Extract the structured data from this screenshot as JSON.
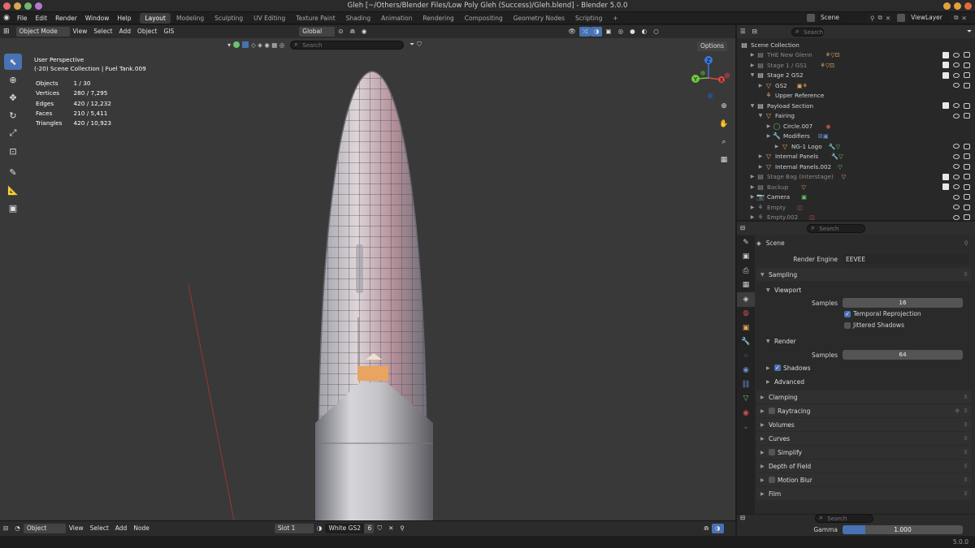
{
  "window": {
    "title": "Gleh [~/Others/Blender Files/Low Poly Gleh (Success)/Gleh.blend] - Blender 5.0.0"
  },
  "menu": [
    "File",
    "Edit",
    "Render",
    "Window",
    "Help"
  ],
  "workspaces": [
    "Layout",
    "Modeling",
    "Sculpting",
    "UV Editing",
    "Texture Paint",
    "Shading",
    "Animation",
    "Rendering",
    "Compositing",
    "Geometry Nodes",
    "Scripting",
    "+"
  ],
  "topright": {
    "scene": "Scene",
    "view_layer": "ViewLayer"
  },
  "viewport_header": {
    "mode": "Object Mode",
    "menus": [
      "View",
      "Select",
      "Add",
      "Object",
      "GIS"
    ],
    "orientation": "Global",
    "options": "Options",
    "search_placeholder": "Search"
  },
  "viewport": {
    "perspective": "User Perspective",
    "collection_line": "(-20) Scene Collection | Fuel Tank.009",
    "stats": [
      {
        "label": "Objects",
        "value": "1 / 30"
      },
      {
        "label": "Vertices",
        "value": "280 / 7,295"
      },
      {
        "label": "Edges",
        "value": "420 / 12,232"
      },
      {
        "label": "Faces",
        "value": "210 / 5,411"
      },
      {
        "label": "Triangles",
        "value": "420 / 10,923"
      }
    ]
  },
  "gizmo": {
    "z": "Z",
    "y": "Y",
    "x": "X"
  },
  "shader_header": {
    "editor": "Object",
    "menus": [
      "View",
      "Select",
      "Add",
      "Node"
    ],
    "slot": "Slot 1",
    "material": "White GS2",
    "users": "6"
  },
  "outliner": {
    "search_placeholder": "Search",
    "rows": [
      {
        "label": "Scene Collection",
        "dim": false
      },
      {
        "label": "THE New Glenn",
        "dim": true
      },
      {
        "label": "Stage 1 / GS1",
        "dim": true
      },
      {
        "label": "Stage 2 GS2",
        "dim": false
      },
      {
        "label": "GS2",
        "dim": false
      },
      {
        "label": "Upper Reference",
        "dim": false
      },
      {
        "label": "Payload Section",
        "dim": false
      },
      {
        "label": "Fairing",
        "dim": false
      },
      {
        "label": "Circle.007",
        "dim": false
      },
      {
        "label": "Modifiers",
        "dim": false
      },
      {
        "label": "NG-1 Logo",
        "dim": false
      },
      {
        "label": "Internal Panels",
        "dim": false
      },
      {
        "label": "Internal Panels.002",
        "dim": false
      },
      {
        "label": "Stage Bag (Interstage)",
        "dim": true
      },
      {
        "label": "Backup",
        "dim": true
      },
      {
        "label": "Camera",
        "dim": false
      },
      {
        "label": "Empty",
        "dim": true
      },
      {
        "label": "Empty.002",
        "dim": true
      }
    ]
  },
  "properties": {
    "search_placeholder": "Search",
    "context": "Scene",
    "render_engine_label": "Render Engine",
    "render_engine": "EEVEE",
    "sampling": "Sampling",
    "viewport": "Viewport",
    "samples_label": "Samples",
    "viewport_samples": "16",
    "temporal_reprojection": "Temporal Reprojection",
    "jittered_shadows": "Jittered Shadows",
    "render": "Render",
    "render_samples": "64",
    "shadows": "Shadows",
    "advanced": "Advanced",
    "panels": [
      "Clamping",
      "Raytracing",
      "Volumes",
      "Curves",
      "Simplify",
      "Depth of Field",
      "Motion Blur",
      "Film"
    ]
  },
  "color_mgmt": {
    "search_placeholder": "Search",
    "gamma_label": "Gamma",
    "gamma_value": "1.000"
  },
  "status": {
    "version": "5.0.0"
  },
  "colors": {
    "accent": "#4772b3",
    "selected_row": "#334d80",
    "fairing_highlight": "#e8a460"
  }
}
